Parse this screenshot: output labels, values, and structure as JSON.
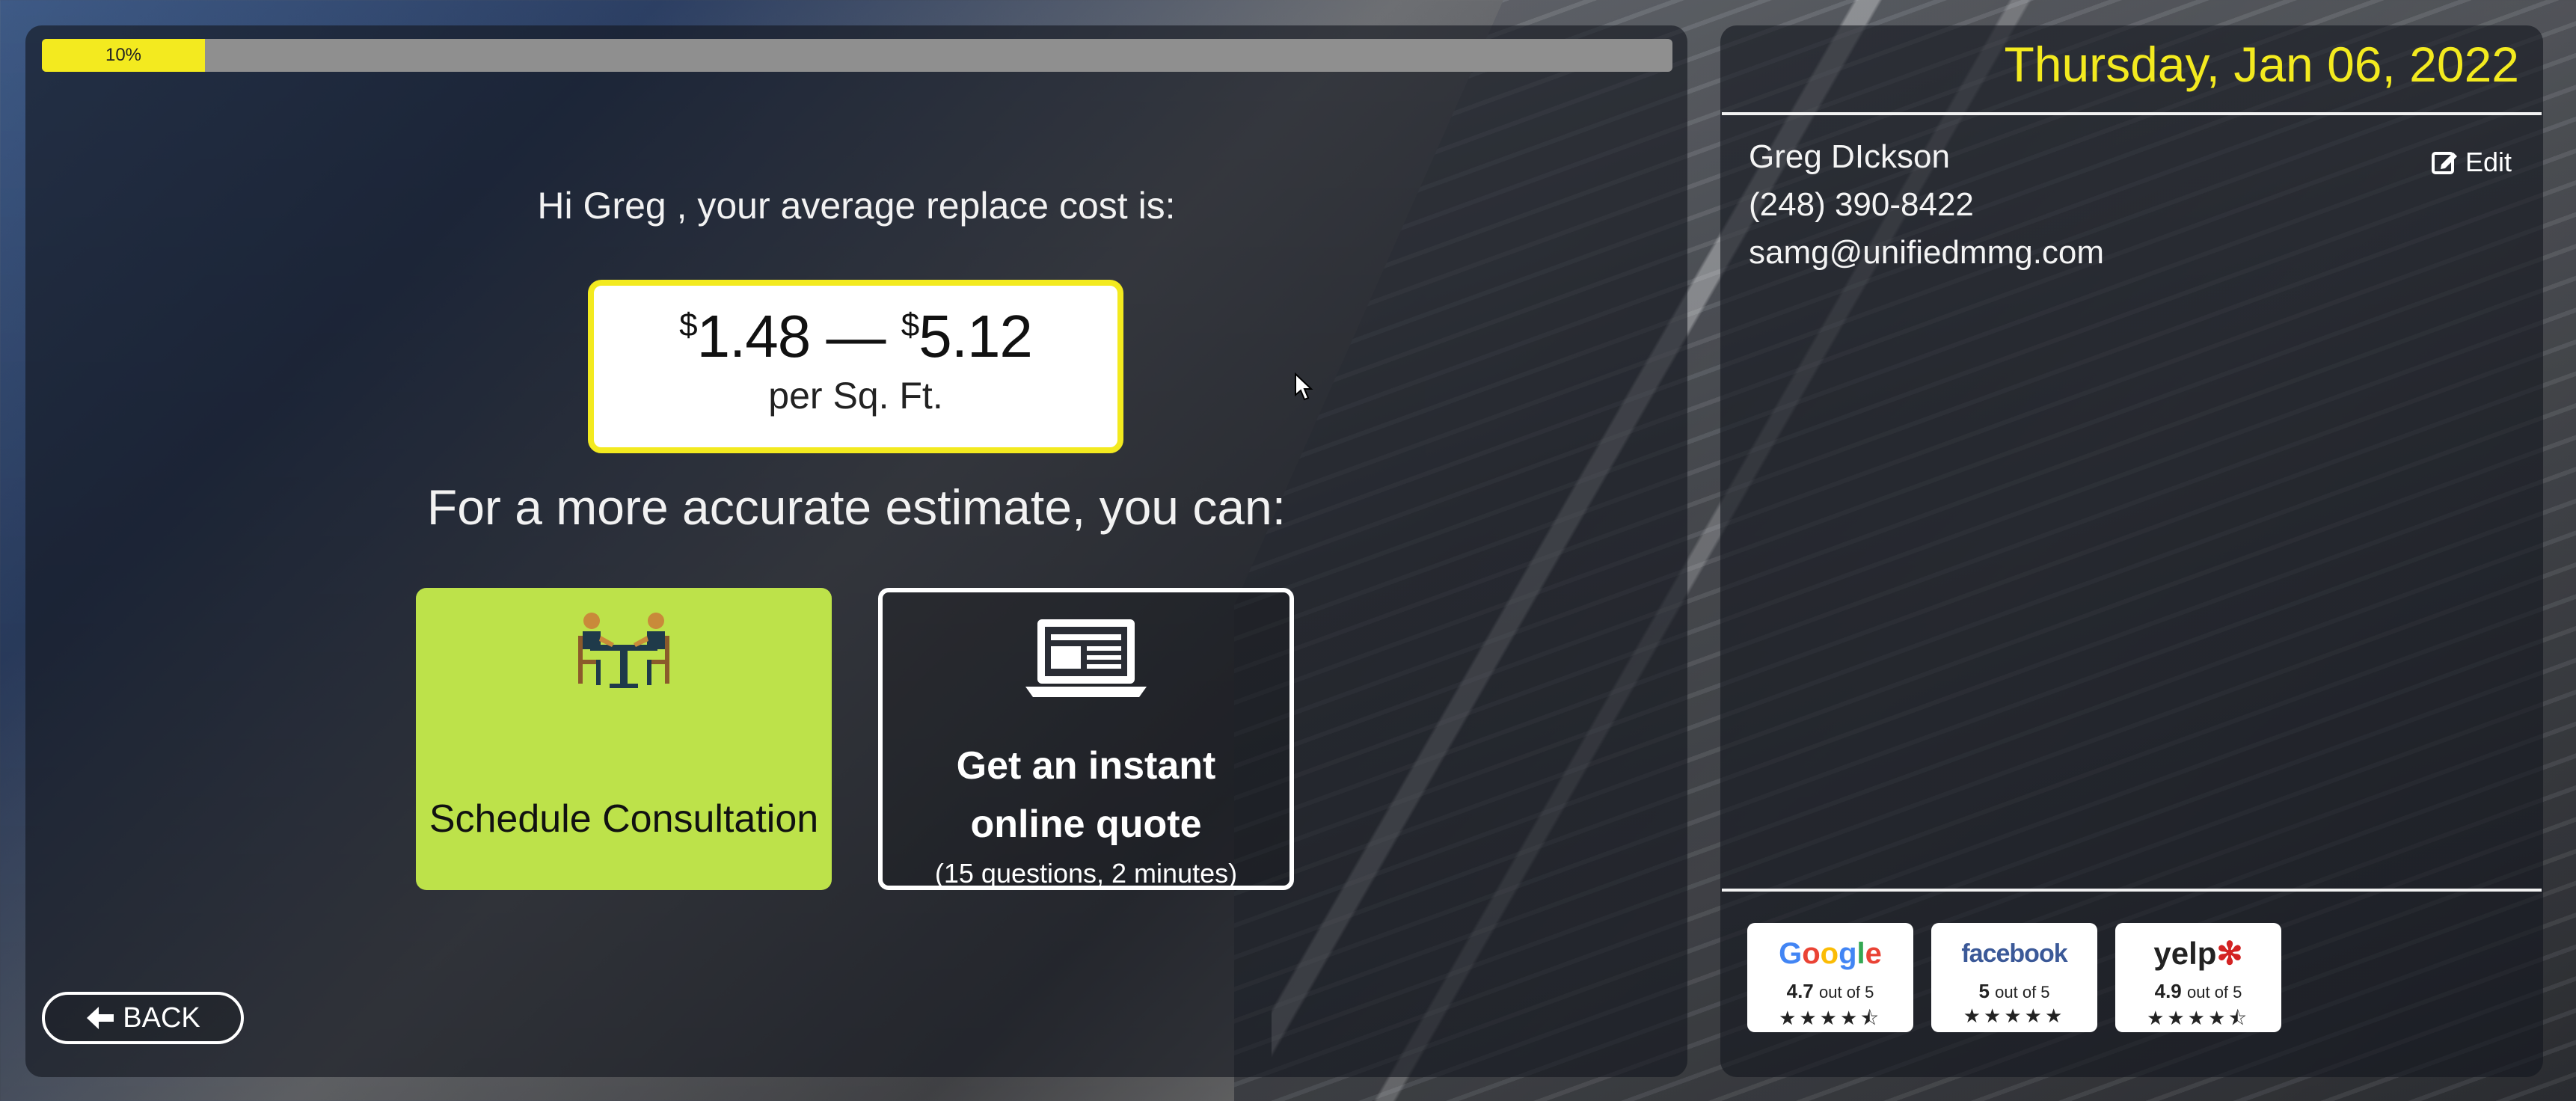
{
  "progress": {
    "label": "10%",
    "value": 0.1
  },
  "main": {
    "greeting": "Hi Greg , your average replace cost is:",
    "price_low": "1.48",
    "price_high": "5.12",
    "currency": "$",
    "dash": "—",
    "price_unit": "per Sq. Ft.",
    "more_text": "For a more accurate estimate, you can:"
  },
  "options": {
    "consult_label": "Schedule Consultation",
    "quote_line1": "Get an instant",
    "quote_line2": "online quote",
    "quote_note": "(15 questions, 2 minutes)"
  },
  "back_label": "BACK",
  "sidebar": {
    "date": "Thursday, Jan 06, 2022",
    "name": "Greg DIckson",
    "phone": "(248) 390-8422",
    "email": "samg@unifiedmmg.com",
    "edit_label": "Edit"
  },
  "reviews": [
    {
      "site": "Google",
      "score": "4.7",
      "suffix": "out of 5",
      "rating": 4.7
    },
    {
      "site": "facebook",
      "score": "5",
      "suffix": "out of 5",
      "rating": 5
    },
    {
      "site": "yelp",
      "score": "4.9",
      "suffix": "out of 5",
      "rating": 4.9
    }
  ],
  "colors": {
    "accent_yellow": "#f3ea1f",
    "consult_green": "#bde24a"
  },
  "icons": [
    "consultation-icon",
    "laptop-icon",
    "back-arrow-icon",
    "edit-icon",
    "star-icon"
  ]
}
